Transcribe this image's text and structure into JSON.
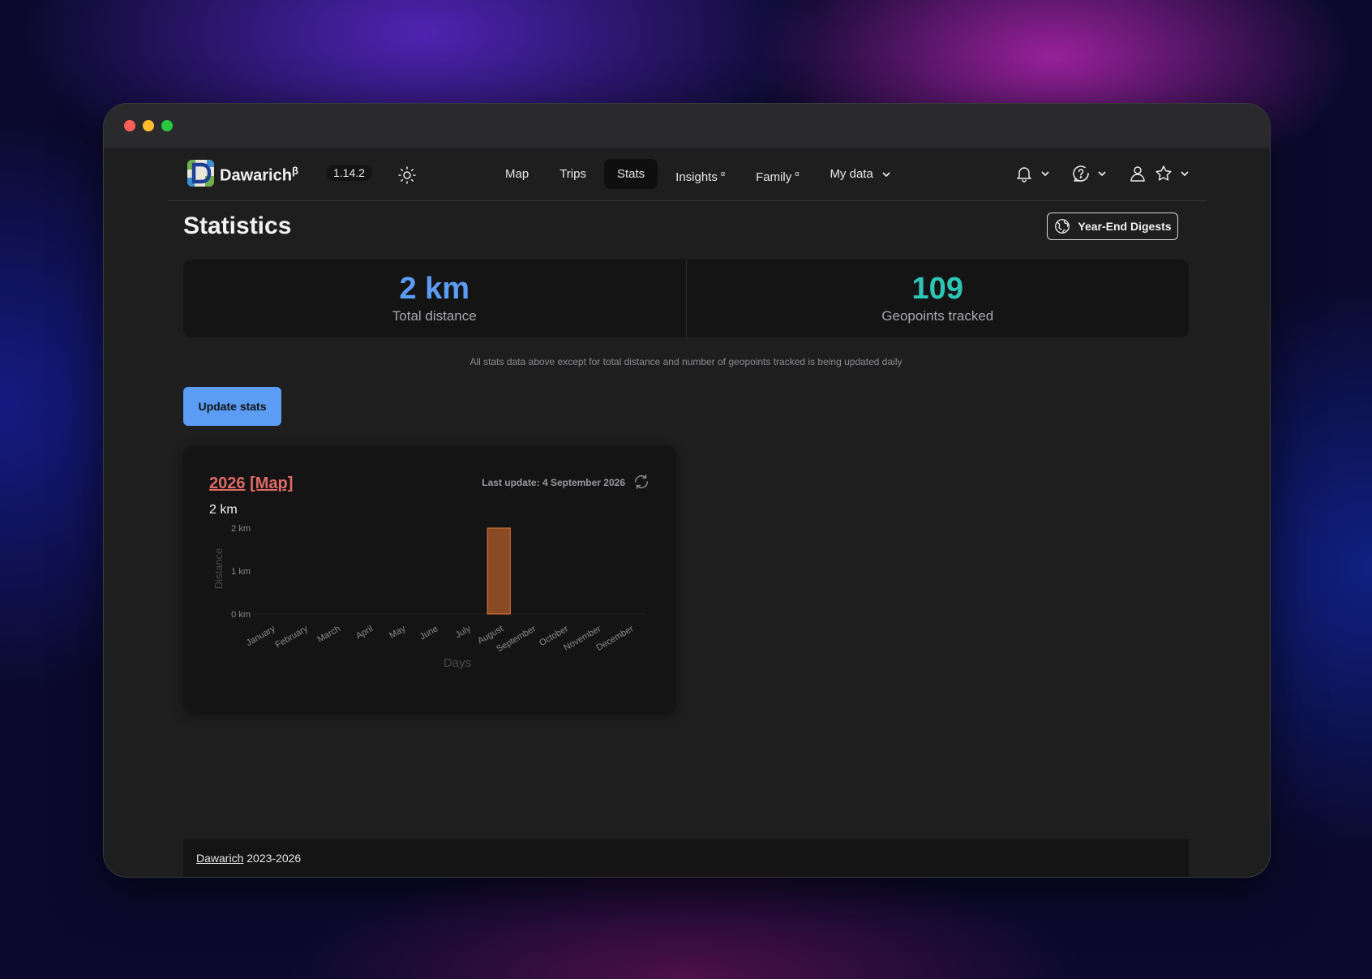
{
  "navbar": {
    "brand": "Dawarich",
    "brand_sup": "β",
    "version": "1.14.2",
    "links": [
      {
        "label": "Map"
      },
      {
        "label": "Trips"
      },
      {
        "label": "Stats"
      },
      {
        "label": "Insights",
        "sup": "α"
      },
      {
        "label": "Family",
        "sup": "α"
      },
      {
        "label": "My data"
      }
    ],
    "active": "Stats"
  },
  "page": {
    "title": "Statistics",
    "digest_button": "Year-End Digests"
  },
  "stats": {
    "distance_value": "2 km",
    "distance_label": "Total distance",
    "geopoints_value": "109",
    "geopoints_label": "Geopoints tracked",
    "colors": {
      "distance": "#5b9df5",
      "geopoints": "#2ec4b6"
    }
  },
  "note": "All stats data above except for total distance and number of geopoints tracked is being updated daily",
  "update_button": "Update stats",
  "year_card": {
    "year": "2026",
    "map_link": "[Map]",
    "last_update": "Last update: 4 September 2026",
    "total": "2 km"
  },
  "chart_data": {
    "type": "bar",
    "categories": [
      "January",
      "February",
      "March",
      "April",
      "May",
      "June",
      "July",
      "August",
      "September",
      "October",
      "November",
      "December"
    ],
    "values": [
      0,
      0,
      0,
      0,
      0,
      0,
      0,
      2,
      0,
      0,
      0,
      0
    ],
    "ylabel": "Distance",
    "xlabel": "Days",
    "yticks": [
      "0 km",
      "1 km",
      "2 km"
    ],
    "ylim": [
      0,
      2
    ],
    "bar_color": "#8a4a26",
    "bar_edge": "#e07a3a"
  },
  "footer": {
    "link": "Dawarich",
    "years": "2023-2026"
  }
}
